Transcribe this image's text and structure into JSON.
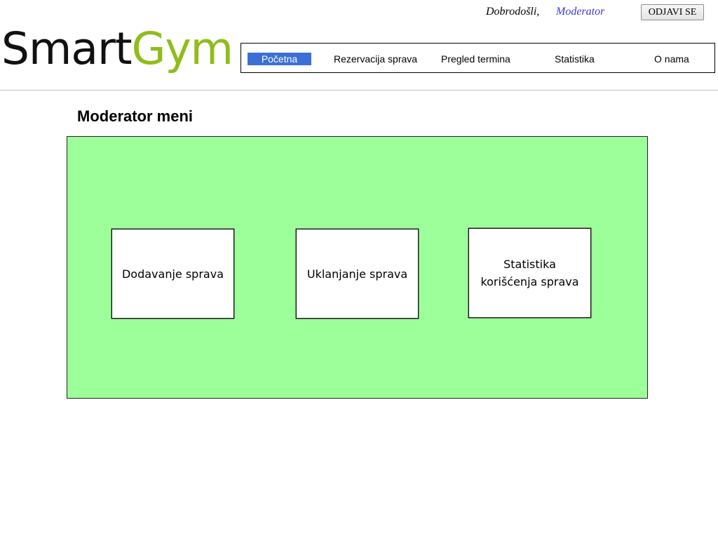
{
  "header": {
    "welcome_text": "Dobrodošli,",
    "username": "Moderator",
    "logout_label": "ODJAVI SE"
  },
  "logo": {
    "part1": "Smart",
    "part2": "Gym",
    "colors": {
      "part1": "#111111",
      "part2": "#8fbd1a"
    }
  },
  "nav": {
    "active_index": 0,
    "items": [
      {
        "label": "Početna"
      },
      {
        "label": "Rezervacija sprava"
      },
      {
        "label": "Pregled termina"
      },
      {
        "label": "Statistika"
      },
      {
        "label": "O nama"
      }
    ],
    "active_color": "#3b6fd6"
  },
  "main": {
    "title": "Moderator meni",
    "panel_color": "#9cff99",
    "cards": [
      {
        "label": "Dodavanje sprava"
      },
      {
        "label": "Uklanjanje sprava"
      },
      {
        "label": "Statistika korišćenja sprava"
      }
    ]
  }
}
